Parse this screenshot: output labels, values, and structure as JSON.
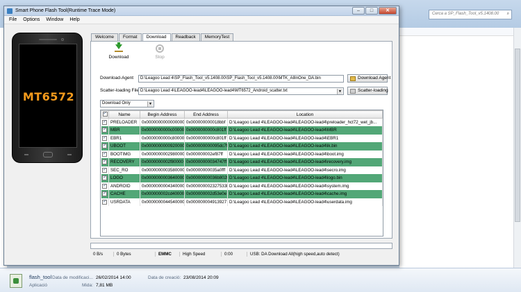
{
  "window": {
    "title": "Smart Phone Flash Tool(Runtime Trace Mode)"
  },
  "menu": [
    "File",
    "Options",
    "Window",
    "Help"
  ],
  "phone": {
    "chip": "MT6572"
  },
  "tabs": [
    "Welcome",
    "Format",
    "Download",
    "Readback",
    "MemoryTest"
  ],
  "toolbar": {
    "download_label": "Download",
    "stop_label": "Stop"
  },
  "agent": {
    "label": "Download-Agent",
    "path": "D:\\Leagoo Lead 4\\SP_Flash_Tool_v5.1408.00\\SP_Flash_Tool_v5.1408.00\\MTK_AllInOne_DA.bin",
    "button": "Download Agent"
  },
  "scatter": {
    "label": "Scatter-loading File",
    "path": "D:\\Leagoo Lead 4\\LEAGOO-lead4\\LEAGOO-lead4\\MT6572_Android_scatter.txt",
    "button": "Scatter-loading"
  },
  "mode": {
    "selected": "Download Only"
  },
  "table": {
    "headers": [
      "Name",
      "Begin Address",
      "End Address",
      "Location"
    ],
    "rows": [
      {
        "name": "PRELOADER",
        "begin": "0x0000000000000000",
        "end": "0x000000000018bbf",
        "loc": "D:\\Leagoo Lead 4\\LEAGOO-lead4\\LEAGOO-lead4\\preloader_hct72_wet_jb...",
        "green": false
      },
      {
        "name": "MBR",
        "begin": "0x0000000000c00000",
        "end": "0x0000000000c801ff",
        "loc": "D:\\Leagoo Lead 4\\LEAGOO-lead4\\LEAGOO-lead4\\MBR",
        "green": true
      },
      {
        "name": "EBR1",
        "begin": "0x0000000000c80000",
        "end": "0x0000000000c801ff",
        "loc": "D:\\Leagoo Lead 4\\LEAGOO-lead4\\LEAGOO-lead4\\EBR1",
        "green": false
      },
      {
        "name": "UBOOT",
        "begin": "0x0000000000920000",
        "end": "0x000000000095dc7f",
        "loc": "D:\\Leagoo Lead 4\\LEAGOO-lead4\\LEAGOO-lead4\\lk.bin",
        "green": true
      },
      {
        "name": "BOOTIMG",
        "begin": "0x0000000002980000",
        "end": "0x000000002ef87ff",
        "loc": "D:\\Leagoo Lead 4\\LEAGOO-lead4\\LEAGOO-lead4\\boot.img",
        "green": false
      },
      {
        "name": "RECOVERY",
        "begin": "0x0000000002f80000",
        "end": "0x00000000034747ff",
        "loc": "D:\\Leagoo Lead 4\\LEAGOO-lead4\\LEAGOO-lead4\\recovery.img",
        "green": true
      },
      {
        "name": "SEC_RO",
        "begin": "0x0000000003580000",
        "end": "0x00000000035a0fff",
        "loc": "D:\\Leagoo Lead 4\\LEAGOO-lead4\\LEAGOO-lead4\\secro.img",
        "green": false
      },
      {
        "name": "LOGO",
        "begin": "0x0000000003640000",
        "end": "0x00000000036b802b",
        "loc": "D:\\Leagoo Lead 4\\LEAGOO-lead4\\LEAGOO-lead4\\logo.bin",
        "green": true
      },
      {
        "name": "ANDROID",
        "begin": "0x0000000004340000",
        "end": "0x000000002327533b",
        "loc": "D:\\Leagoo Lead 4\\LEAGOO-lead4\\LEAGOO-lead4\\system.img",
        "green": false
      },
      {
        "name": "CACHE",
        "begin": "0x000000002cd40000",
        "end": "0x000000002d53e0e7",
        "loc": "D:\\Leagoo Lead 4\\LEAGOO-lead4\\LEAGOO-lead4\\cache.img",
        "green": true
      },
      {
        "name": "USRDATA",
        "begin": "0x0000000044540000",
        "end": "0x000000004913927",
        "loc": "D:\\Leagoo Lead 4\\LEAGOO-lead4\\LEAGOO-lead4\\userdata.img",
        "green": false
      }
    ]
  },
  "status": {
    "speed": "0 B/s",
    "bytes": "0 Bytes",
    "storage": "EMMC",
    "usb_speed": "High Speed",
    "time": "0:00",
    "message": "USB: DA Download All(high speed,auto detect)"
  },
  "explorer": {
    "search_placeholder": "Cerca a SP_Flash_Tool_v5.1408.00",
    "file_name": "flash_tool",
    "file_type": "Aplicació",
    "modified_label": "Data de modificaci...",
    "modified_value": "26/02/2014 14:00",
    "size_label": "Mida:",
    "size_value": "7,81 MB",
    "created_label": "Data de creació:",
    "created_value": "23/08/2014 20:09"
  }
}
